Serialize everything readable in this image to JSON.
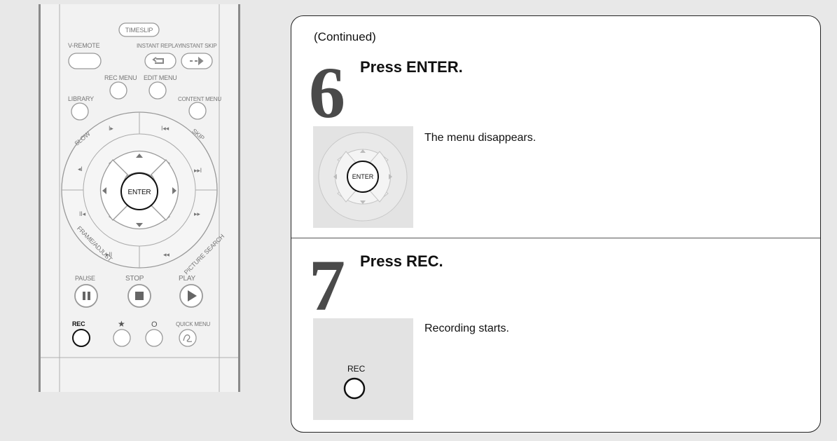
{
  "remote": {
    "timeslip": "TIMESLIP",
    "v_remote": "V-REMOTE",
    "instant_replay": "INSTANT REPLAY",
    "instant_skip": "INSTANT SKIP",
    "rec_menu": "REC MENU",
    "edit_menu": "EDIT MENU",
    "library": "LIBRARY",
    "content_menu": "CONTENT MENU",
    "slow": "SLOW",
    "skip": "SKIP",
    "enter": "ENTER",
    "frame_adjust": "FRAME/ADJUST",
    "picture_search": "PICTURE SEARCH",
    "pause": "PAUSE",
    "stop": "STOP",
    "play": "PLAY",
    "rec": "REC",
    "star": "★",
    "circle": "O",
    "quick_menu": "QUICK MENU"
  },
  "panel": {
    "continued": "(Continued)",
    "steps": [
      {
        "number": "6",
        "title": "Press ENTER.",
        "text": "The menu disappears.",
        "thumb_label": "ENTER"
      },
      {
        "number": "7",
        "title": "Press REC.",
        "text": "Recording starts.",
        "thumb_label": "REC"
      }
    ]
  }
}
